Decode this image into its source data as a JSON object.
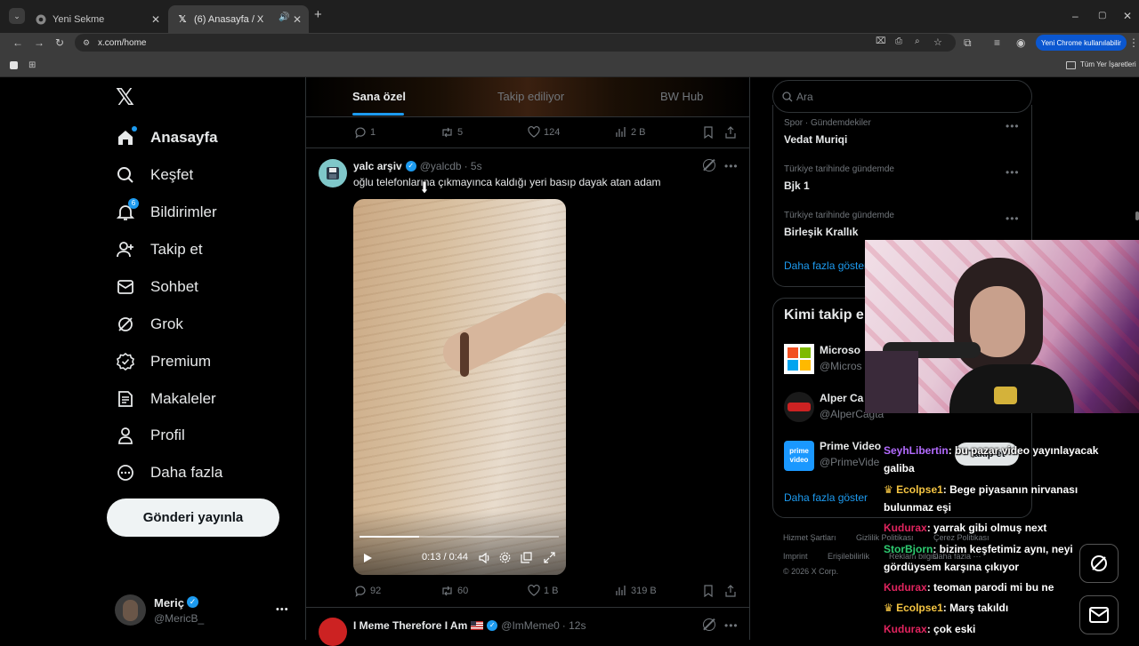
{
  "browser": {
    "tabs": [
      {
        "title": "Yeni Sekme",
        "close": "✕"
      },
      {
        "title": "(6) Anasayfa / X",
        "close": "✕"
      }
    ],
    "new_tab": "+",
    "url": "x.com/home",
    "promo_label": "Yeni Chrome kullanılabilir",
    "bookmarks_all": "Tüm Yer İşaretleri",
    "window": {
      "min": "–",
      "max": "▢",
      "close": "✕"
    }
  },
  "sidebar": {
    "items": [
      {
        "label": "Anasayfa",
        "icon": "home-icon"
      },
      {
        "label": "Keşfet",
        "icon": "search-icon"
      },
      {
        "label": "Bildirimler",
        "icon": "bell-icon",
        "badge": "6"
      },
      {
        "label": "Takip et",
        "icon": "follow-icon"
      },
      {
        "label": "Sohbet",
        "icon": "mail-icon"
      },
      {
        "label": "Grok",
        "icon": "grok-icon"
      },
      {
        "label": "Premium",
        "icon": "premium-icon"
      },
      {
        "label": "Makaleler",
        "icon": "articles-icon"
      },
      {
        "label": "Profil",
        "icon": "profile-icon"
      },
      {
        "label": "Daha fazla",
        "icon": "more-icon"
      }
    ],
    "post_button": "Gönderi yayınla",
    "account": {
      "name": "Meriç",
      "handle": "@MericB_",
      "menu": "•••"
    }
  },
  "feed": {
    "tabs": [
      "Sana özel",
      "Takip ediliyor",
      "BW Hub"
    ],
    "prev_actions": {
      "replies": "1",
      "reposts": "5",
      "likes": "124",
      "views": "2 B"
    },
    "post": {
      "name": "yalc arşiv",
      "handle": "@yalcdb",
      "time": "· 5s",
      "text": "oğlu telefonlarına çıkmayınca kaldığı yeri basıp dayak atan adam",
      "video_time": "0:13 / 0:44",
      "video_progress": 0.3,
      "actions": {
        "replies": "92",
        "reposts": "60",
        "likes": "1 B",
        "views": "319 B"
      }
    },
    "next_post": {
      "name": "I Meme Therefore I Am",
      "handle": "@ImMeme0",
      "time": "· 12s"
    }
  },
  "right": {
    "search_placeholder": "Ara",
    "trends": [
      {
        "meta": "Spor · Gündemdekiler",
        "title": "Vedat Muriqi"
      },
      {
        "meta": "Türkiye tarihinde gündemde",
        "title": "Bjk 1"
      },
      {
        "meta": "Türkiye tarihinde gündemde",
        "title": "Birleşik Krallık"
      }
    ],
    "show_more": "Daha fazla göster",
    "who_to_follow_title": "Kimi takip e",
    "follow": [
      {
        "name": "Microso",
        "handle": "@Micros"
      },
      {
        "name": "Alper Ca",
        "handle": "@AlperCagta"
      },
      {
        "name": "Prime Video",
        "handle": "@PrimeVide"
      }
    ],
    "follow_button": "Takip et",
    "show_more_2": "Daha fazla göster",
    "footer": [
      "Hizmet Şartları",
      "Gizlilik Politikası",
      "Çerez Politikası",
      "Imprint",
      "Erişilebilirlik",
      "Reklam bilgisi",
      "Daha fazla ···",
      "© 2026 X Corp."
    ]
  },
  "stream_chat": [
    {
      "user": "SeyhLibertin",
      "color": "#b36bff",
      "text": ": bu pazar video yayınlayacak galiba"
    },
    {
      "user": "Ecolpse1",
      "color": "#f5c542",
      "text": ": Bege piyasanın nirvanası bulunmaz eşi",
      "badge": true
    },
    {
      "user": "Kudurax",
      "color": "#e0245e",
      "text": ": yarrak gibi olmuş next"
    },
    {
      "user": "StorBjorn",
      "color": "#2ecc71",
      "text": ": bizim keşfetimiz aynı, neyi gördüysem karşına çıkıyor"
    },
    {
      "user": "Kudurax",
      "color": "#e0245e",
      "text": ": teoman parodi mi bu ne"
    },
    {
      "user": "Ecolpse1",
      "color": "#f5c542",
      "text": ": Marş takıldı",
      "badge": true
    },
    {
      "user": "Kudurax",
      "color": "#e0245e",
      "text": ": çok eski"
    }
  ]
}
